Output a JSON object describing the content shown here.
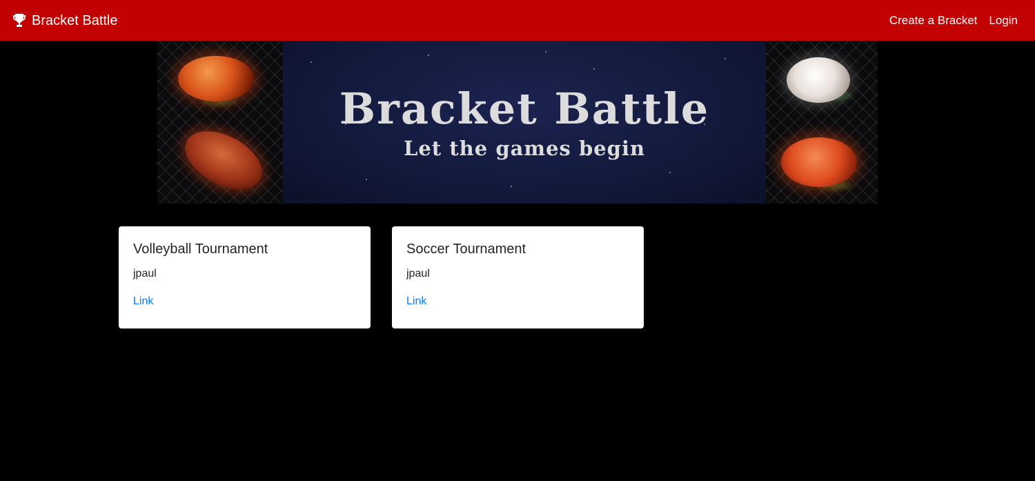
{
  "navbar": {
    "brand_label": "Bracket Battle",
    "brand_icon": "trophy-icon",
    "links": [
      {
        "label": "Create a Bracket"
      },
      {
        "label": "Login"
      }
    ],
    "color": "#c20202"
  },
  "banner": {
    "title": "Bracket Battle",
    "subtitle": "Let the games begin"
  },
  "tournaments": [
    {
      "title": "Volleyball Tournament",
      "owner": "jpaul",
      "link_label": "Link"
    },
    {
      "title": "Soccer Tournament",
      "owner": "jpaul",
      "link_label": "Link"
    }
  ],
  "colors": {
    "background": "#000000",
    "link": "#007bff",
    "card": "#ffffff"
  }
}
